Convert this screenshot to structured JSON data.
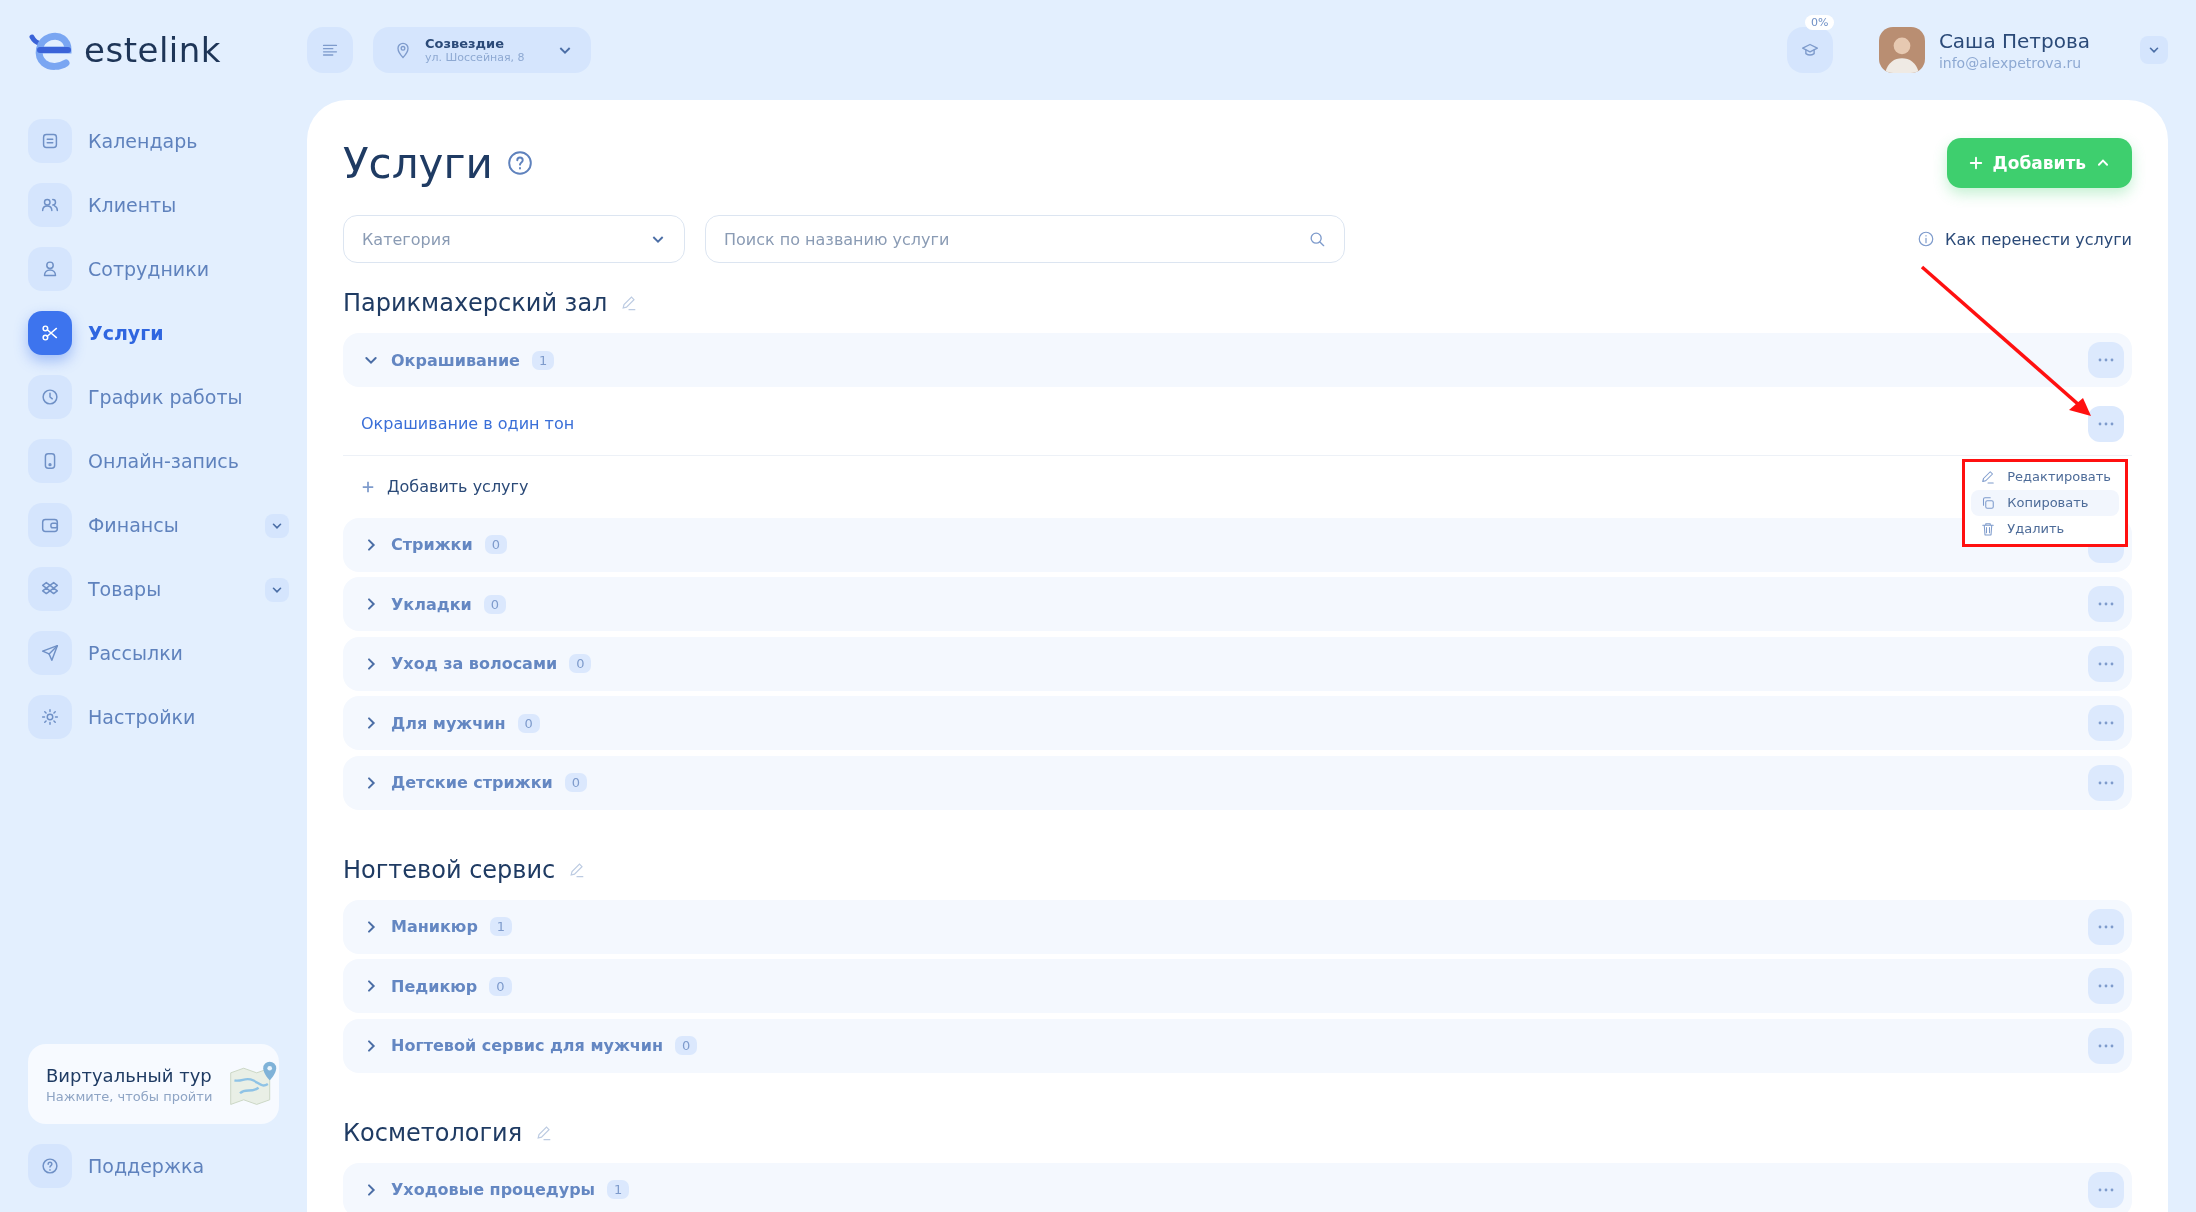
{
  "logo": {
    "text": "estelink"
  },
  "topbar": {
    "location": {
      "name": "Созвездие",
      "address": "ул. Шоссейная, 8"
    },
    "progress_badge": "0%",
    "user": {
      "name": "Саша Петрова",
      "email": "info@alexpetrova.ru"
    }
  },
  "sidebar": {
    "items": [
      {
        "label": "Календарь",
        "selected": false,
        "has_submenu": false
      },
      {
        "label": "Клиенты",
        "selected": false,
        "has_submenu": false
      },
      {
        "label": "Сотрудники",
        "selected": false,
        "has_submenu": false
      },
      {
        "label": "Услуги",
        "selected": true,
        "has_submenu": false
      },
      {
        "label": "График работы",
        "selected": false,
        "has_submenu": false
      },
      {
        "label": "Онлайн-запись",
        "selected": false,
        "has_submenu": false
      },
      {
        "label": "Финансы",
        "selected": false,
        "has_submenu": true
      },
      {
        "label": "Товары",
        "selected": false,
        "has_submenu": true
      },
      {
        "label": "Рассылки",
        "selected": false,
        "has_submenu": false
      },
      {
        "label": "Настройки",
        "selected": false,
        "has_submenu": false
      }
    ],
    "tour_card": {
      "title": "Виртуальный тур",
      "subtitle": "Нажмите, чтобы пройти"
    },
    "support": {
      "label": "Поддержка"
    }
  },
  "page": {
    "title": "Услуги",
    "add_button": "Добавить",
    "category_filter": {
      "placeholder": "Категория"
    },
    "search": {
      "placeholder": "Поиск по названию услуги"
    },
    "help_link": "Как перенести услуги",
    "add_service_label": "Добавить услугу"
  },
  "sections": [
    {
      "title": "Парикмахерский зал",
      "categories": [
        {
          "name": "Окрашивание",
          "count": "1",
          "expanded": true,
          "services": [
            {
              "name": "Окрашивание в один тон",
              "menu_open": true
            }
          ]
        },
        {
          "name": "Стрижки",
          "count": "0",
          "expanded": false
        },
        {
          "name": "Укладки",
          "count": "0",
          "expanded": false
        },
        {
          "name": "Уход за волосами",
          "count": "0",
          "expanded": false
        },
        {
          "name": "Для мужчин",
          "count": "0",
          "expanded": false
        },
        {
          "name": "Детские стрижки",
          "count": "0",
          "expanded": false
        }
      ]
    },
    {
      "title": "Ногтевой сервис",
      "categories": [
        {
          "name": "Маникюр",
          "count": "1",
          "expanded": false
        },
        {
          "name": "Педикюр",
          "count": "0",
          "expanded": false
        },
        {
          "name": "Ногтевой сервис для мужчин",
          "count": "0",
          "expanded": false
        }
      ]
    },
    {
      "title": "Косметология",
      "categories": [
        {
          "name": "Уходовые процедуры",
          "count": "1",
          "expanded": false
        }
      ]
    }
  ],
  "context_menu": {
    "items": [
      {
        "label": "Редактировать",
        "highlighted": false
      },
      {
        "label": "Копировать",
        "highlighted": true
      },
      {
        "label": "Удалить",
        "highlighted": false
      }
    ]
  }
}
